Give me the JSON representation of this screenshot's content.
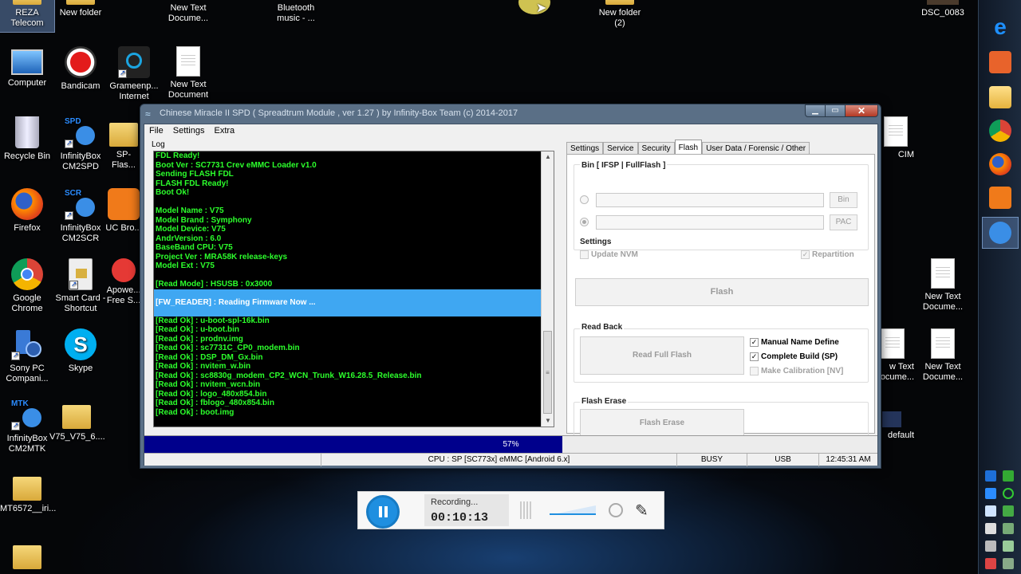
{
  "window": {
    "title": "Chinese Miracle II SPD ( Spreadtrum Module , ver 1.27 ) by Infinity-Box Team (c) 2014-2017",
    "min": "▁",
    "max": "▭",
    "close": "✕",
    "menu": [
      "File",
      "Settings",
      "Extra"
    ]
  },
  "log": {
    "label": "Log",
    "before": [
      "FDL Ready!",
      "Boot Ver : SC7731 Crev eMMC Loader v1.0",
      "Sending FLASH FDL",
      "FLASH FDL Ready!",
      "Boot Ok!",
      "",
      "Model Name  : V75",
      "Model Brand : Symphony",
      "Model Device: V75",
      "AndrVersion : 6.0",
      "BaseBand CPU: V75",
      "Project Ver : MRA58K release-keys",
      "Model Ext   : V75",
      "",
      "[Read Mode] : HSUSB : 0x3000"
    ],
    "highlight": "[FW_READER] : Reading Firmware Now ...",
    "after": [
      "[Read Ok] : u-boot-spl-16k.bin",
      "[Read Ok] : u-boot.bin",
      "[Read Ok] : prodnv.img",
      "[Read Ok] : sc7731C_CP0_modem.bin",
      "[Read Ok] : DSP_DM_Gx.bin",
      "[Read Ok] : nvitem_w.bin",
      "[Read Ok] : sc8830g_modem_CP2_WCN_Trunk_W16.28.5_Release.bin",
      "[Read Ok] : nvitem_wcn.bin",
      "[Read Ok] : logo_480x854.bin",
      "[Read Ok] : fblogo_480x854.bin",
      "[Read Ok] : boot.img"
    ]
  },
  "tabs": [
    "Settings",
    "Service",
    "Security",
    "Flash",
    "User Data / Forensic / Other"
  ],
  "flash": {
    "bin_group": "Bin  [ IFSP | FullFlash ]",
    "bin_btn": "Bin",
    "pac_btn": "PAC",
    "settings_group": "Settings",
    "update_nvm": "Update NVM",
    "repartition": "Repartition",
    "flash_btn": "Flash",
    "readback_group": "Read Back",
    "read_full_flash": "Read Full Flash",
    "manual_name": "Manual Name Define",
    "complete_build": "Complete Build (SP)",
    "make_calibration": "Make Calibration [NV]",
    "erase_group": "Flash Erase",
    "erase_btn": "Flash Erase"
  },
  "progress": {
    "value": 57,
    "label": "57%"
  },
  "status": {
    "cpu": "CPU : SP [SC773x] eMMC [Android 6.x]",
    "state": "BUSY",
    "port": "USB",
    "time": "12:45:31 AM"
  },
  "recorder": {
    "status": "Recording...",
    "time": "00:10:13"
  },
  "desktop": {
    "reza": "REZA Telecom",
    "new_folder": "New folder",
    "new_text_doc_1": "New Text Docume...",
    "bluetooth": "Bluetooth music - ...",
    "new_folder_2": "New folder (2)",
    "dsc": "DSC_0083",
    "computer": "Computer",
    "bandicam": "Bandicam",
    "grameenphone": "Grameenp... Internet",
    "new_text_doc_2": "New Text Document",
    "recycle": "Recycle Bin",
    "infinity_spd": "InfinityBox CM2SPD",
    "sp_flash": "SP-Flas...",
    "firefox": "Firefox",
    "infinity_scr": "InfinityBox CM2SCR",
    "uc": "UC Bro...",
    "chrome": "Google Chrome",
    "smartcard": "Smart Card - Shortcut",
    "apowe": "Apowe... Free S...",
    "sony": "Sony PC Compani...",
    "skype": "Skype",
    "infinity_mtk": "InfinityBox CM2MTK",
    "v75": "V75_V75_6....",
    "mt6572": "MT6572__iri...",
    "cim": "CIM",
    "new_text_r1": "New Text Docume...",
    "new_text_r2": "w Text ocume...",
    "new_text_r3": "New Text Docume...",
    "default": "default",
    "spd_badge": "SPD",
    "scr_badge": "SCR",
    "mtk_badge": "MTK"
  },
  "colors": {
    "log_text": "#2cff2c",
    "log_highlight": "#3fa7f2",
    "progress": "#00008c",
    "recorder_button": "#1f8fe0"
  }
}
